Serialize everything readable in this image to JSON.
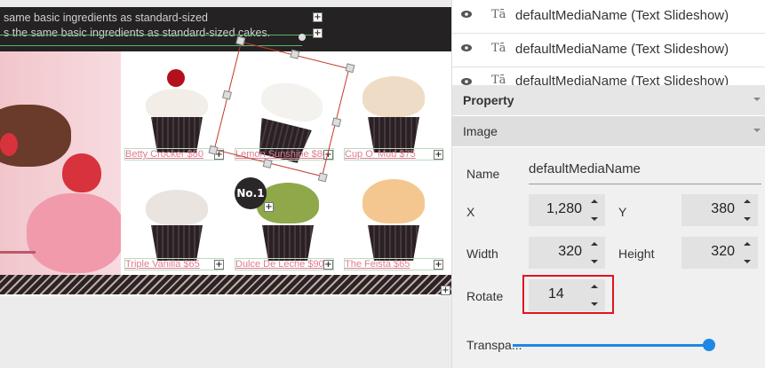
{
  "canvas": {
    "headline_1": "same basic ingredients as standard-sized",
    "headline_2": "s the same basic ingredients as standard-sized cakes.",
    "plus": "+",
    "badge": "No.1",
    "products": [
      {
        "label": "Betty Crocker $80"
      },
      {
        "label": "Lemon Sunshine $80"
      },
      {
        "label": "Cup O' Mud $75"
      },
      {
        "label": "Triple Vanilla $65"
      },
      {
        "label": "Dulce De Leche $90"
      },
      {
        "label": "The Feista $65"
      }
    ]
  },
  "layers": [
    {
      "icon": "eye-icon",
      "type_icon": "Tā",
      "name": "defaultMediaName (Text Slideshow)"
    },
    {
      "icon": "eye-icon",
      "type_icon": "Tā",
      "name": "defaultMediaName (Text Slideshow)"
    },
    {
      "icon": "eye-icon",
      "type_icon": "Tā",
      "name": "defaultMediaName (Text Slideshow)"
    }
  ],
  "panel": {
    "property_title": "Property",
    "image_title": "Image",
    "name_label": "Name",
    "name_value": "defaultMediaName",
    "x_label": "X",
    "x_value": "1,280",
    "y_label": "Y",
    "y_value": "380",
    "width_label": "Width",
    "width_value": "320",
    "height_label": "Height",
    "height_value": "320",
    "rotate_label": "Rotate",
    "rotate_value": "14",
    "transparency_label": "Transpa...",
    "transparency_level": 1.0
  },
  "colors": {
    "accent": "#1e88e5",
    "highlight": "#e0141e",
    "selection": "#c0392b",
    "price_text": "#e07a93"
  }
}
